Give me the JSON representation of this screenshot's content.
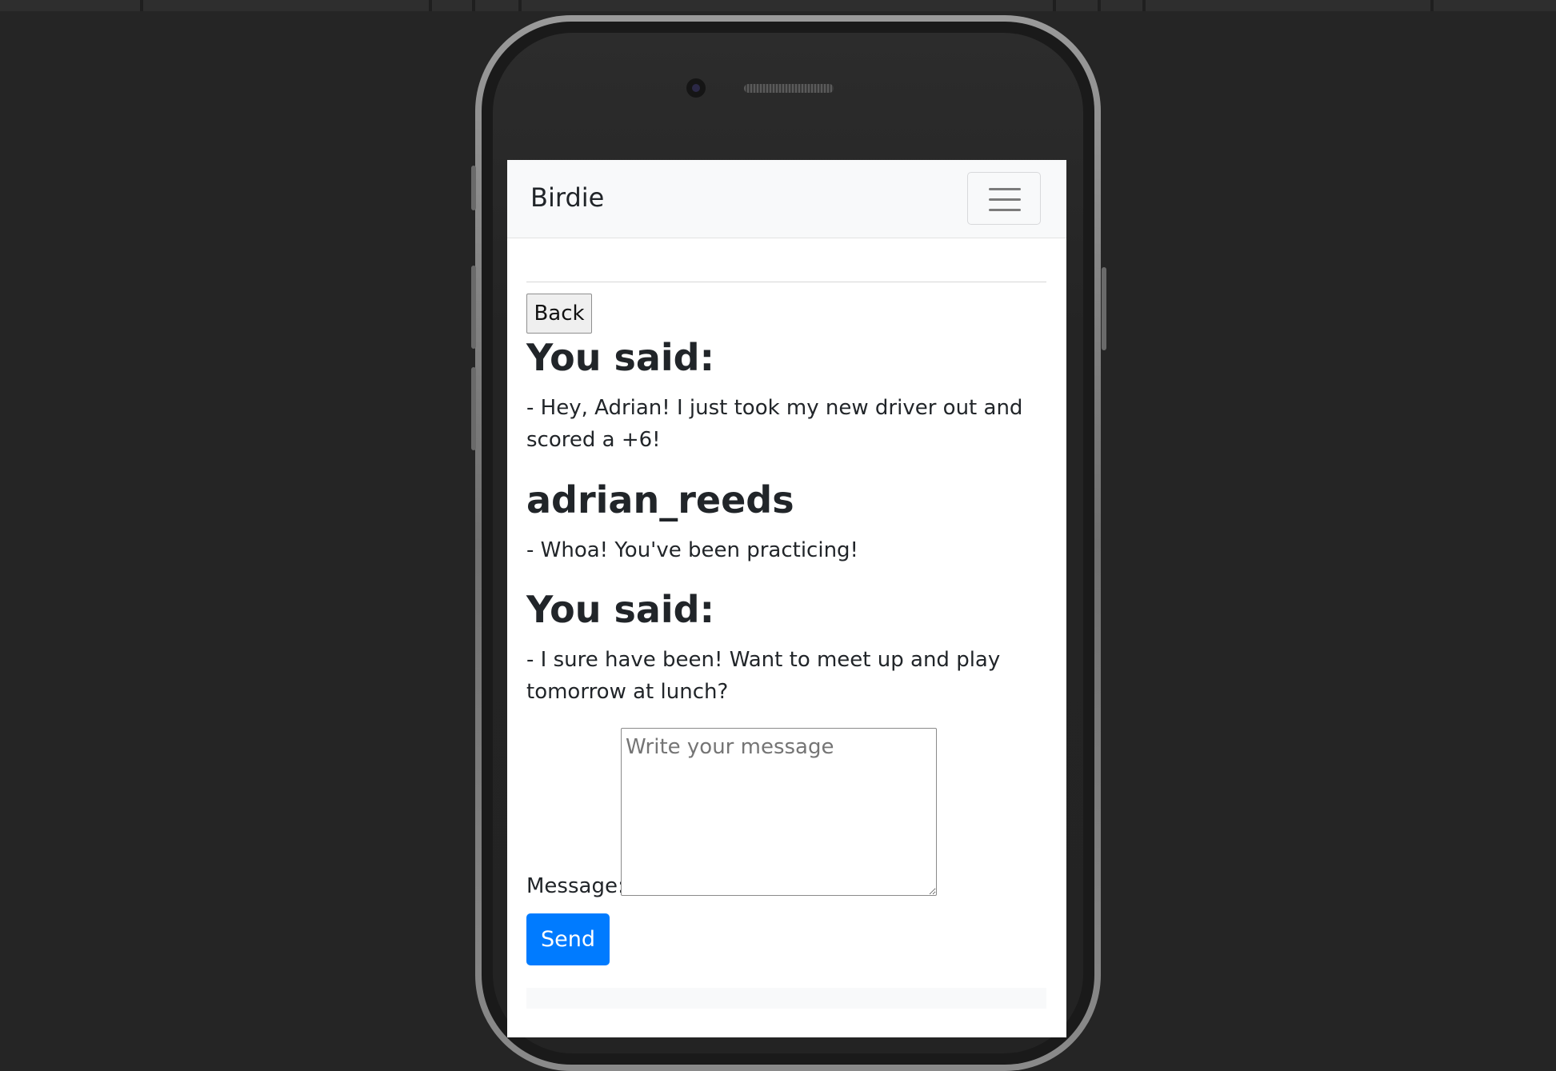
{
  "app": {
    "brand": "Birdie"
  },
  "actions": {
    "back_label": "Back",
    "send_label": "Send"
  },
  "conversation": [
    {
      "sender": "You said:",
      "text": "- Hey, Adrian! I just took my new driver out and scored a +6!"
    },
    {
      "sender": "adrian_reeds",
      "text": "- Whoa! You've been practicing!"
    },
    {
      "sender": "You said:",
      "text": "- I sure have been! Want to meet up and play tomorrow at lunch?"
    }
  ],
  "composer": {
    "label": "Message:",
    "placeholder": "Write your message",
    "value": ""
  },
  "colors": {
    "primary": "#007bff",
    "navbar_bg": "#f8f9fa",
    "text": "#212529",
    "backdrop": "#252525"
  }
}
